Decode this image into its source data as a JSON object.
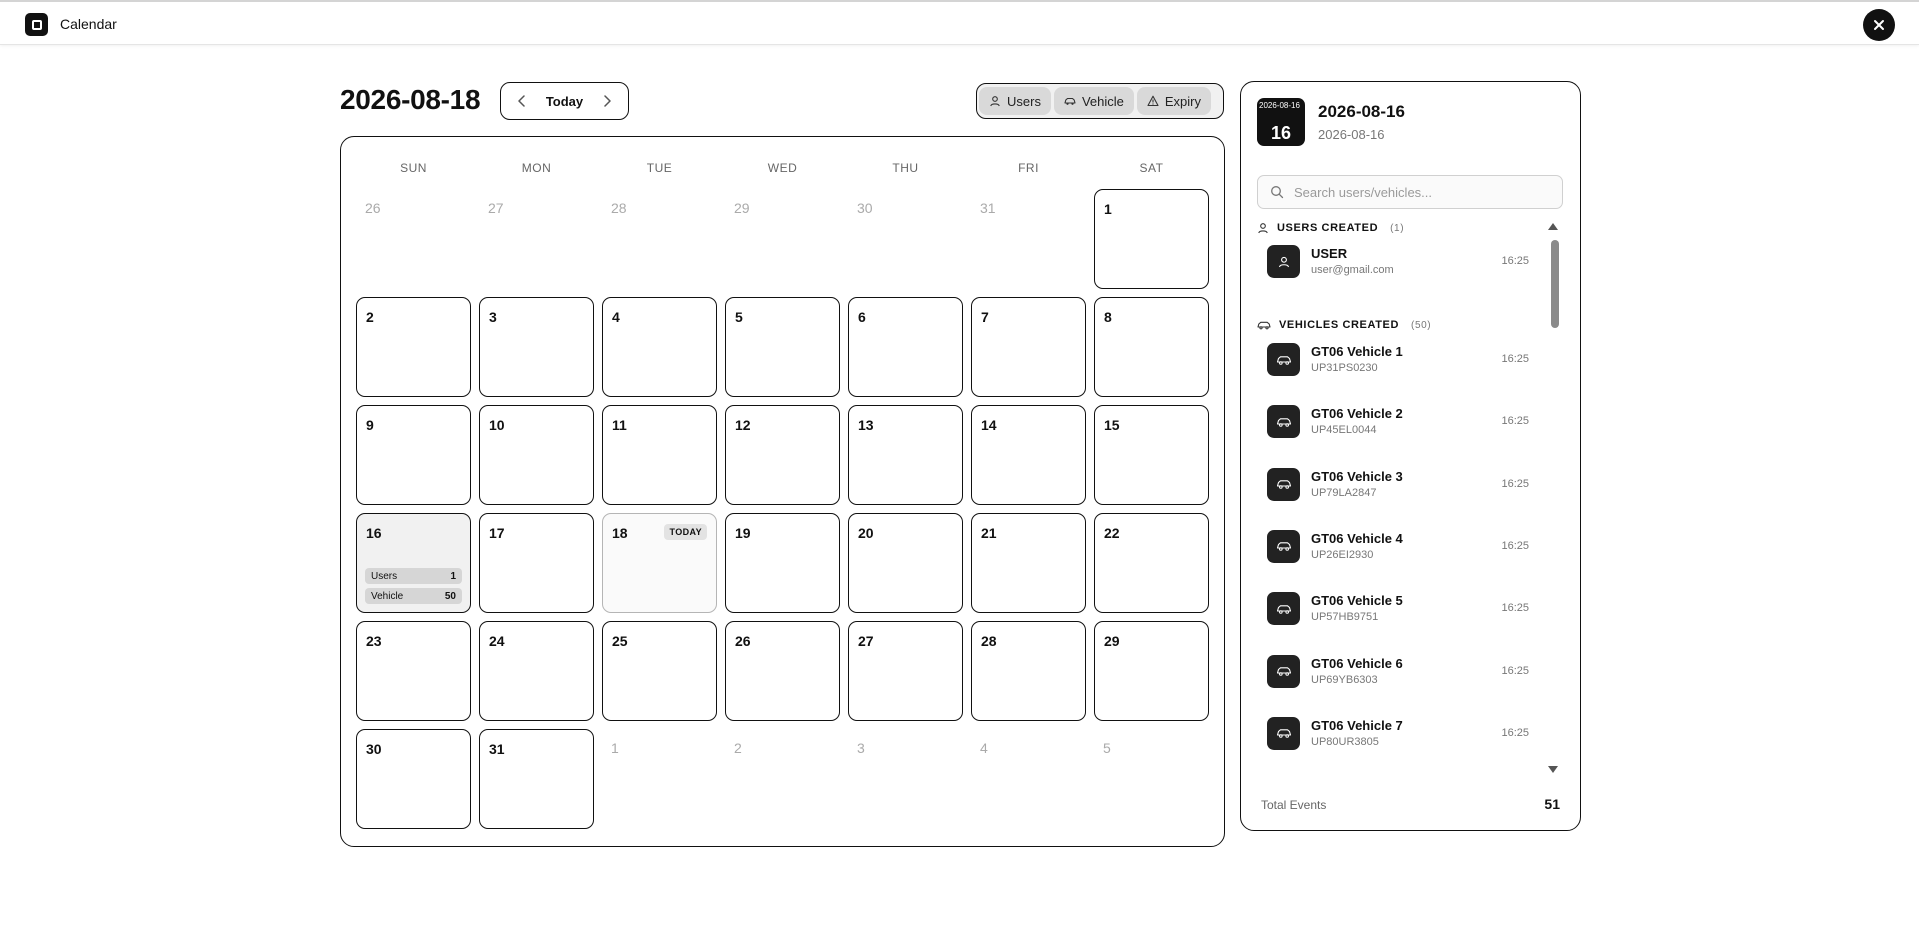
{
  "app": {
    "title": "Calendar"
  },
  "header": {
    "current_date": "2026-08-18",
    "today_label": "Today"
  },
  "filters": [
    {
      "label": "Users",
      "icon": "user-icon"
    },
    {
      "label": "Vehicle",
      "icon": "car-icon"
    },
    {
      "label": "Expiry",
      "icon": "warning-icon"
    }
  ],
  "calendar": {
    "weekdays": [
      "SUN",
      "MON",
      "TUE",
      "WED",
      "THU",
      "FRI",
      "SAT"
    ],
    "weeks": [
      [
        {
          "d": "26",
          "out": true
        },
        {
          "d": "27",
          "out": true
        },
        {
          "d": "28",
          "out": true
        },
        {
          "d": "29",
          "out": true
        },
        {
          "d": "30",
          "out": true
        },
        {
          "d": "31",
          "out": true
        },
        {
          "d": "1"
        }
      ],
      [
        {
          "d": "2"
        },
        {
          "d": "3"
        },
        {
          "d": "4"
        },
        {
          "d": "5"
        },
        {
          "d": "6"
        },
        {
          "d": "7"
        },
        {
          "d": "8"
        }
      ],
      [
        {
          "d": "9"
        },
        {
          "d": "10"
        },
        {
          "d": "11"
        },
        {
          "d": "12"
        },
        {
          "d": "13"
        },
        {
          "d": "14"
        },
        {
          "d": "15"
        }
      ],
      [
        {
          "d": "16",
          "selected": true,
          "tags": [
            {
              "label": "Users",
              "count": "1"
            },
            {
              "label": "Vehicle",
              "count": "50"
            }
          ]
        },
        {
          "d": "17"
        },
        {
          "d": "18",
          "today": true
        },
        {
          "d": "19"
        },
        {
          "d": "20"
        },
        {
          "d": "21"
        },
        {
          "d": "22"
        }
      ],
      [
        {
          "d": "23"
        },
        {
          "d": "24"
        },
        {
          "d": "25"
        },
        {
          "d": "26"
        },
        {
          "d": "27"
        },
        {
          "d": "28"
        },
        {
          "d": "29"
        }
      ],
      [
        {
          "d": "30"
        },
        {
          "d": "31"
        },
        {
          "d": "1",
          "out": true
        },
        {
          "d": "2",
          "out": true
        },
        {
          "d": "3",
          "out": true
        },
        {
          "d": "4",
          "out": true
        },
        {
          "d": "5",
          "out": true
        }
      ]
    ],
    "today_badge": "TODAY"
  },
  "panel": {
    "badge_small": "2026-08-16",
    "badge_big": "16",
    "title": "2026-08-16",
    "subtitle": "2026-08-16",
    "search_placeholder": "Search users/vehicles...",
    "users_section": {
      "label": "USERS CREATED",
      "count": "(1)"
    },
    "users": [
      {
        "name": "USER",
        "sub": "user@gmail.com",
        "time": "16:25"
      }
    ],
    "vehicles_section": {
      "label": "VEHICLES CREATED",
      "count": "(50)"
    },
    "vehicles": [
      {
        "name": "GT06 Vehicle 1",
        "sub": "UP31PS0230",
        "time": "16:25"
      },
      {
        "name": "GT06 Vehicle 2",
        "sub": "UP45EL0044",
        "time": "16:25"
      },
      {
        "name": "GT06 Vehicle 3",
        "sub": "UP79LA2847",
        "time": "16:25"
      },
      {
        "name": "GT06 Vehicle 4",
        "sub": "UP26EI2930",
        "time": "16:25"
      },
      {
        "name": "GT06 Vehicle 5",
        "sub": "UP57HB9751",
        "time": "16:25"
      },
      {
        "name": "GT06 Vehicle 6",
        "sub": "UP69YB6303",
        "time": "16:25"
      },
      {
        "name": "GT06 Vehicle 7",
        "sub": "UP80UR3805",
        "time": "16:25"
      }
    ],
    "total_label": "Total Events",
    "total_value": "51"
  }
}
